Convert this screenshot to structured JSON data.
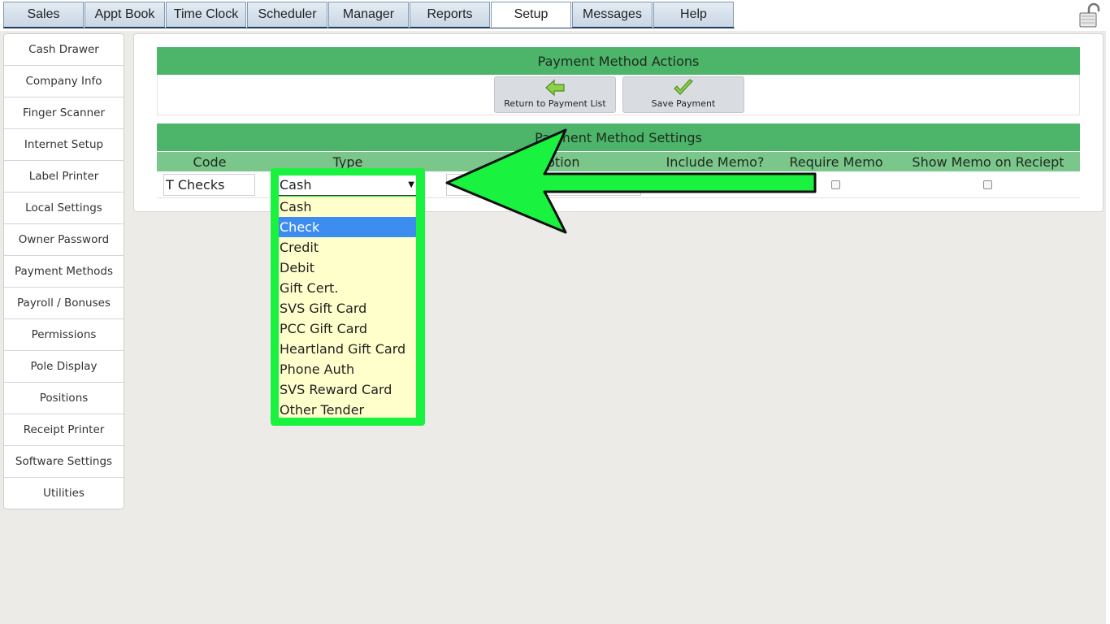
{
  "tabs": [
    {
      "label": "Sales",
      "active": false
    },
    {
      "label": "Appt Book",
      "active": false
    },
    {
      "label": "Time Clock",
      "active": false
    },
    {
      "label": "Scheduler",
      "active": false
    },
    {
      "label": "Manager",
      "active": false
    },
    {
      "label": "Reports",
      "active": false
    },
    {
      "label": "Setup",
      "active": true
    },
    {
      "label": "Messages",
      "active": false
    },
    {
      "label": "Help",
      "active": false
    }
  ],
  "header_icon": "lock-icon",
  "sidebar": {
    "items": [
      {
        "label": "Cash Drawer"
      },
      {
        "label": "Company Info"
      },
      {
        "label": "Finger Scanner"
      },
      {
        "label": "Internet Setup"
      },
      {
        "label": "Label Printer"
      },
      {
        "label": "Local Settings"
      },
      {
        "label": "Owner Password"
      },
      {
        "label": "Payment Methods"
      },
      {
        "label": "Payroll / Bonuses"
      },
      {
        "label": "Permissions"
      },
      {
        "label": "Pole Display"
      },
      {
        "label": "Positions"
      },
      {
        "label": "Receipt Printer"
      },
      {
        "label": "Software Settings"
      },
      {
        "label": "Utilities"
      }
    ]
  },
  "actions": {
    "title": "Payment Method Actions",
    "return_label": "Return to Payment List",
    "save_label": "Save Payment",
    "return_icon": "arrow-left-icon",
    "save_icon": "checkmark-icon"
  },
  "settings": {
    "title": "Payment Method Settings",
    "columns": {
      "code": "Code",
      "type": "Type",
      "description": "Description",
      "include_memo": "Include Memo?",
      "require_memo": "Require Memo",
      "show_memo": "Show Memo on Reciept"
    },
    "row": {
      "code": "T Checks",
      "type": "Cash",
      "description": "",
      "require_memo": false,
      "show_memo": false
    }
  },
  "type_dropdown": {
    "selected": "Cash",
    "highlighted": "Check",
    "options": [
      "Cash",
      "Check",
      "Credit",
      "Debit",
      "Gift Cert.",
      "SVS Gift Card",
      "PCC Gift Card",
      "Heartland Gift Card",
      "Phone Auth",
      "SVS Reward Card",
      "Other Tender"
    ]
  },
  "colors": {
    "section_header": "#4cb56a",
    "column_header": "#7bc68b",
    "highlight_frame": "#19f23f",
    "dropdown_bg": "#ffffcc",
    "selected_option": "#3d8df1",
    "annotation_arrow": "#19f23f"
  }
}
